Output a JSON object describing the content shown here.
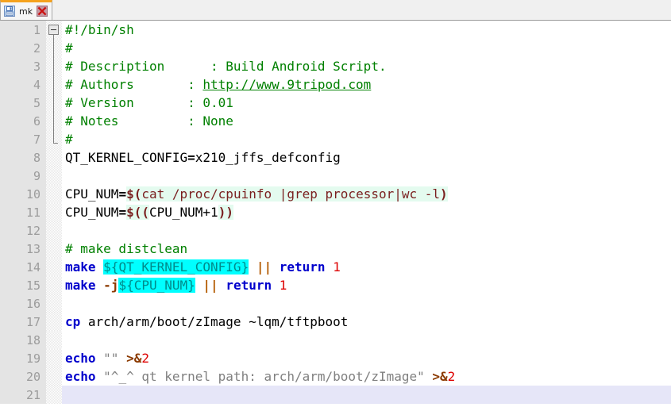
{
  "window": {
    "title": "mk",
    "accent_color": "#f5a21e"
  },
  "tabbar": {
    "tabs": [
      {
        "label": "mk",
        "save_icon": "floppy-disk-icon",
        "close_icon": "close-icon",
        "active": true
      }
    ]
  },
  "editor": {
    "current_line": 21,
    "total_lines": 21,
    "colors": {
      "comment": "#008000",
      "keyword": "#0000cc",
      "number": "#dd0000",
      "operator": "#8b3a00",
      "string": "#808080",
      "variable_highlight": "#00ffff",
      "subst_highlight": "#e4fbef",
      "current_line_bg": "#e6e6f8",
      "gutter_bg": "#e4e4e4",
      "gutter_fg": "#9c9c9c"
    },
    "lines": [
      {
        "n": "1",
        "fold": "start",
        "tokens": [
          {
            "t": "comment",
            "v": "#!/bin/sh"
          }
        ]
      },
      {
        "n": "2",
        "fold": "bar",
        "tokens": [
          {
            "t": "comment",
            "v": "#"
          }
        ]
      },
      {
        "n": "3",
        "fold": "bar",
        "tokens": [
          {
            "t": "comment",
            "v": "# Description      : Build Android Script."
          }
        ]
      },
      {
        "n": "4",
        "fold": "bar",
        "tokens": [
          {
            "t": "comment",
            "v": "# Authors       : "
          },
          {
            "t": "link",
            "v": "http://www.9tripod.com"
          }
        ]
      },
      {
        "n": "5",
        "fold": "bar",
        "tokens": [
          {
            "t": "comment",
            "v": "# Version       : 0.01"
          }
        ]
      },
      {
        "n": "6",
        "fold": "bar",
        "tokens": [
          {
            "t": "comment",
            "v": "# Notes         : None"
          }
        ]
      },
      {
        "n": "7",
        "fold": "end",
        "tokens": [
          {
            "t": "comment",
            "v": "#"
          }
        ]
      },
      {
        "n": "8",
        "fold": "none",
        "tokens": [
          {
            "t": "plain",
            "v": "QT_KERNEL_CONFIG"
          },
          {
            "t": "eq",
            "v": "="
          },
          {
            "t": "plain",
            "v": "x210_jffs_defconfig"
          }
        ]
      },
      {
        "n": "9",
        "fold": "none",
        "tokens": []
      },
      {
        "n": "10",
        "fold": "none",
        "tokens": [
          {
            "t": "plain",
            "v": "CPU_NUM"
          },
          {
            "t": "eq",
            "v": "="
          },
          {
            "t": "subst",
            "v": "$("
          },
          {
            "t": "substplain",
            "v": "cat /proc/cpuinfo |grep processor|wc -l"
          },
          {
            "t": "subst",
            "v": ")"
          }
        ]
      },
      {
        "n": "11",
        "fold": "none",
        "tokens": [
          {
            "t": "plain",
            "v": "CPU_NUM"
          },
          {
            "t": "eq",
            "v": "="
          },
          {
            "t": "subst",
            "v": "$(("
          },
          {
            "t": "plain",
            "v": "CPU_NUM+1"
          },
          {
            "t": "subst",
            "v": "))"
          }
        ]
      },
      {
        "n": "12",
        "fold": "none",
        "tokens": []
      },
      {
        "n": "13",
        "fold": "none",
        "tokens": [
          {
            "t": "comment",
            "v": "# make distclean"
          }
        ]
      },
      {
        "n": "14",
        "fold": "none",
        "tokens": [
          {
            "t": "kw",
            "v": "make"
          },
          {
            "t": "plain",
            "v": " "
          },
          {
            "t": "var",
            "v": "${QT_KERNEL_CONFIG}"
          },
          {
            "t": "plain",
            "v": " "
          },
          {
            "t": "pipe",
            "v": "||"
          },
          {
            "t": "plain",
            "v": " "
          },
          {
            "t": "kw",
            "v": "return"
          },
          {
            "t": "plain",
            "v": " "
          },
          {
            "t": "num",
            "v": "1"
          }
        ]
      },
      {
        "n": "15",
        "fold": "none",
        "tokens": [
          {
            "t": "kw",
            "v": "make"
          },
          {
            "t": "plain",
            "v": " "
          },
          {
            "t": "op",
            "v": "-j"
          },
          {
            "t": "var",
            "v": "${CPU_NUM}"
          },
          {
            "t": "plain",
            "v": " "
          },
          {
            "t": "pipe",
            "v": "||"
          },
          {
            "t": "plain",
            "v": " "
          },
          {
            "t": "kw",
            "v": "return"
          },
          {
            "t": "plain",
            "v": " "
          },
          {
            "t": "num",
            "v": "1"
          }
        ]
      },
      {
        "n": "16",
        "fold": "none",
        "tokens": []
      },
      {
        "n": "17",
        "fold": "none",
        "tokens": [
          {
            "t": "kw",
            "v": "cp"
          },
          {
            "t": "plain",
            "v": " arch/arm/boot/zImage ~lqm/tftpboot"
          }
        ]
      },
      {
        "n": "18",
        "fold": "none",
        "tokens": []
      },
      {
        "n": "19",
        "fold": "none",
        "tokens": [
          {
            "t": "kw",
            "v": "echo"
          },
          {
            "t": "plain",
            "v": " "
          },
          {
            "t": "str",
            "v": "\"\""
          },
          {
            "t": "plain",
            "v": " "
          },
          {
            "t": "op",
            "v": ">&"
          },
          {
            "t": "num",
            "v": "2"
          }
        ]
      },
      {
        "n": "20",
        "fold": "none",
        "tokens": [
          {
            "t": "kw",
            "v": "echo"
          },
          {
            "t": "plain",
            "v": " "
          },
          {
            "t": "str",
            "v": "\"^_^ qt kernel path: arch/arm/boot/zImage\""
          },
          {
            "t": "plain",
            "v": " "
          },
          {
            "t": "op",
            "v": ">&"
          },
          {
            "t": "num",
            "v": "2"
          }
        ]
      },
      {
        "n": "21",
        "fold": "none",
        "tokens": []
      }
    ]
  }
}
